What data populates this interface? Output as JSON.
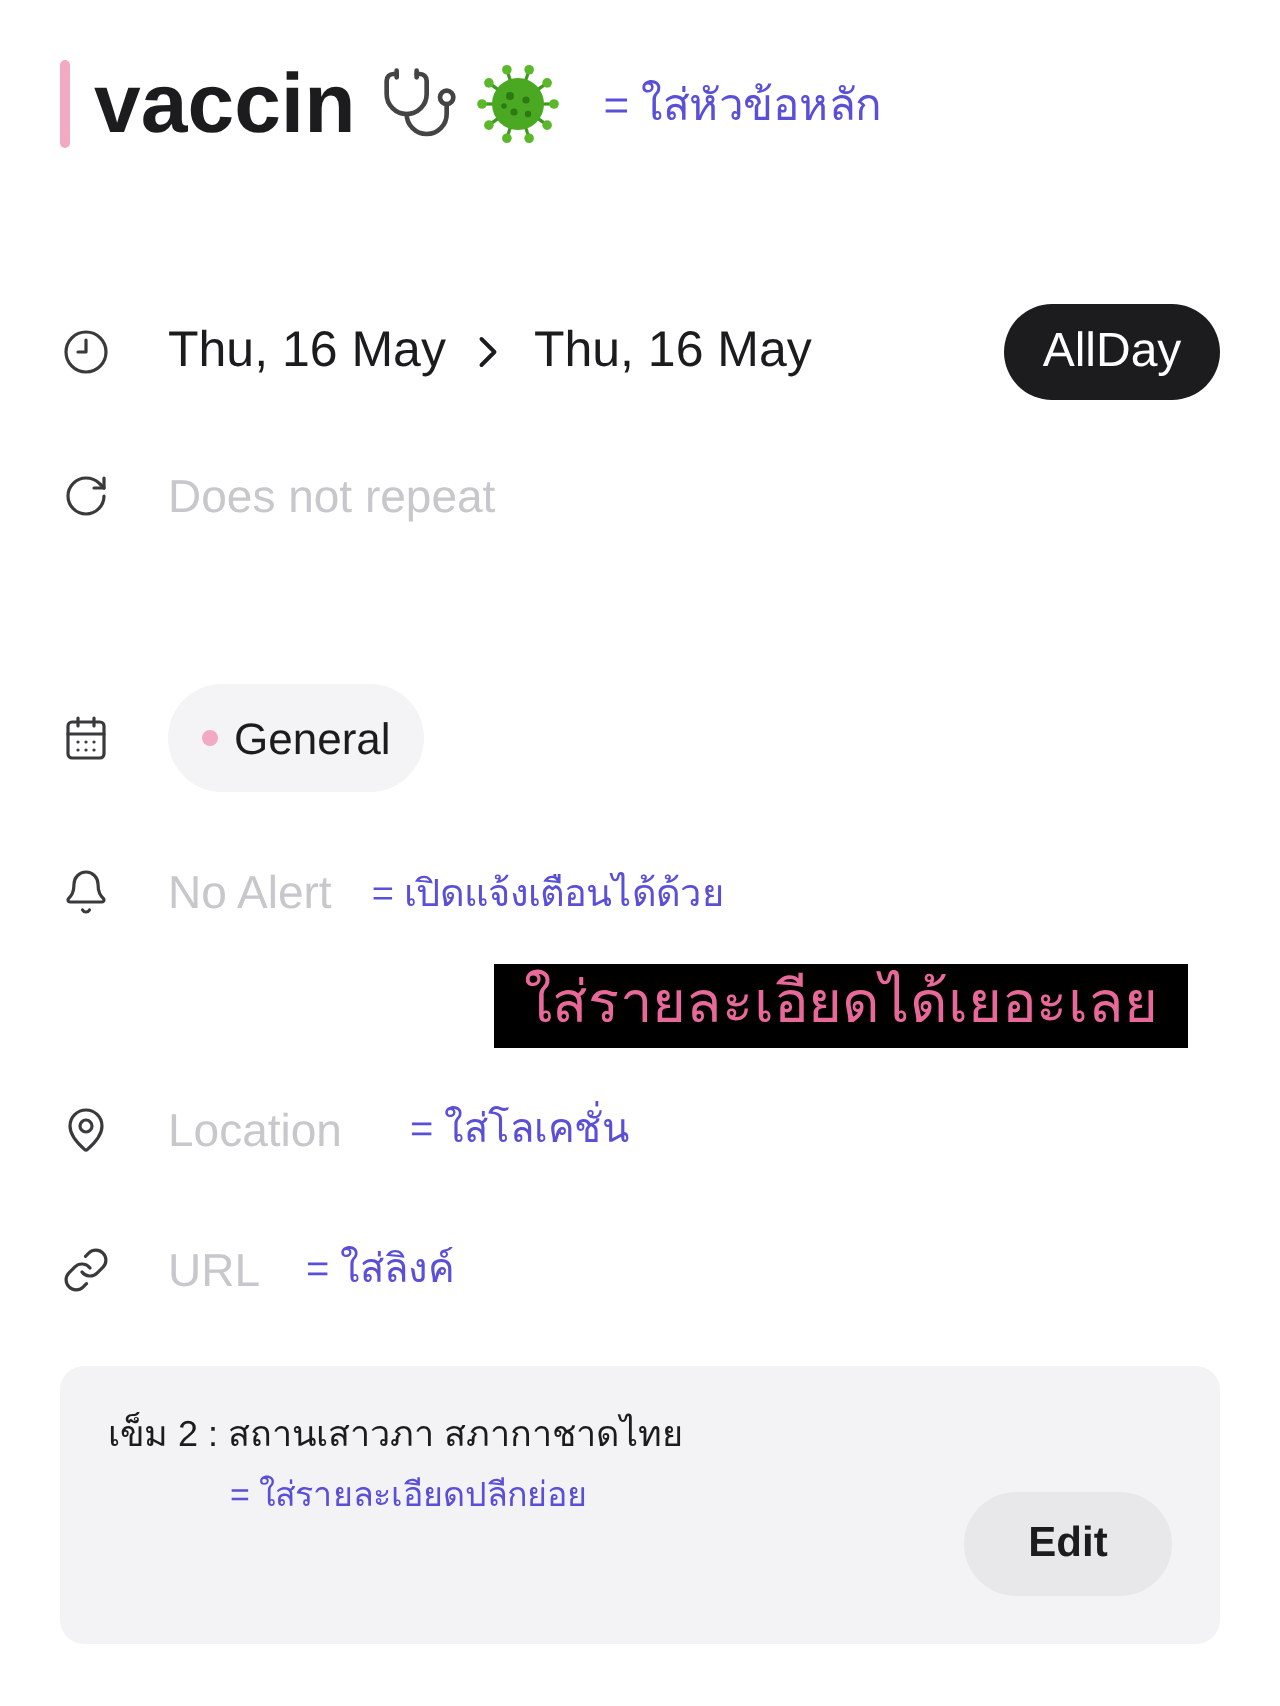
{
  "title": {
    "text": "vaccin",
    "note": "= ใส่หัวข้อหลัก"
  },
  "date_range": {
    "start": "Thu, 16 May",
    "end": "Thu, 16 May",
    "all_day": {
      "label": "AllDay",
      "on": true
    }
  },
  "repeat": {
    "value": "Does not repeat"
  },
  "calendar": {
    "label": "General"
  },
  "alert": {
    "value": "No Alert",
    "note": "= เปิดแจ้งเตือนได้ด้วย"
  },
  "banner": "ใส่รายละเอียดได้เยอะเลย",
  "location": {
    "placeholder": "Location",
    "note": "= ใส่โลเคชั่น"
  },
  "url": {
    "placeholder": "URL",
    "note": "= ใส่ลิงค์"
  },
  "notes": {
    "text": "เข็ม 2 : สถานเสาวภา สภากาชาดไทย",
    "note": "= ใส่รายละเอียดปลีกย่อย",
    "button": "Edit"
  }
}
